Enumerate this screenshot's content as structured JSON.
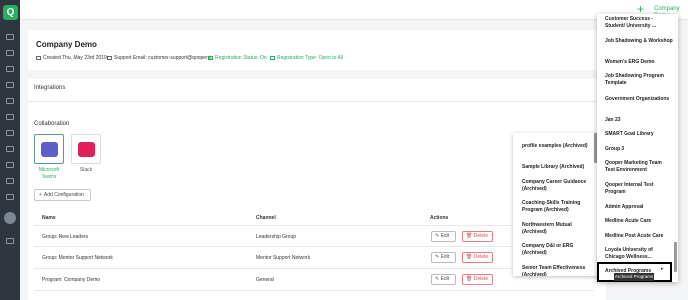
{
  "topbar": {
    "add_icon": "+",
    "org_selector": "Company Demo"
  },
  "sidebar": {
    "logo_letter": "Q"
  },
  "header": {
    "title": "Company Demo",
    "created": "Created Thu, May 23rd 2019",
    "support_email": "Support Email: customer-support@qooper.io",
    "registration_status": "Registration Status: On",
    "registration_type": "Registration Type: Open to All"
  },
  "content": {
    "integrations_title": "Integrations",
    "collaboration_title": "Collaboration",
    "integrations": [
      {
        "label": "Microsoft Teams",
        "icon": "microsoft-teams-icon",
        "color": "#5b5fc7"
      },
      {
        "label": "Slack",
        "icon": "slack-icon",
        "color": "#e01e5a"
      }
    ],
    "add_configuration": "Add Configuration",
    "table": {
      "headers": [
        "Name",
        "Channel",
        "Actions"
      ],
      "rows": [
        {
          "name": "Group: New Leaders",
          "channel": "Leadership Group"
        },
        {
          "name": "Group: Mentor Support Network",
          "channel": "Mentor Support Network"
        },
        {
          "name": "Program: Company Demo",
          "channel": "General"
        }
      ],
      "edit_label": "Edit",
      "delete_label": "Delete"
    }
  },
  "middle_dropdown": {
    "items": [
      "profile examples (Archived)",
      "Sample Library (Archived)",
      "Company Career Guidance (Archived)",
      "Coaching-Skills Training Program (Archived)",
      "Northwestern Mutual (Archived)",
      "Company D&I or ERG (Archived)",
      "Senior Team Effectiveness (Archived)"
    ]
  },
  "right_dropdown": {
    "items": [
      "Customer Success - Student/ University ...",
      "Job Shadowing & Workshop",
      "Women's ERG Demo",
      "Job Shadowing Program Template",
      "Government Organizations",
      "Jan 23",
      "SMART Goal Library",
      "Group 3",
      "Qooper Marketing Team Test Environment",
      "Qooper Internal Test Program",
      "Admin Approval",
      "Medline Acute Care",
      "Medline Post Acute Care",
      "Loyola University of Chicago Wellness...",
      "Archived Programs"
    ],
    "tooltip": "Archived Programs"
  }
}
